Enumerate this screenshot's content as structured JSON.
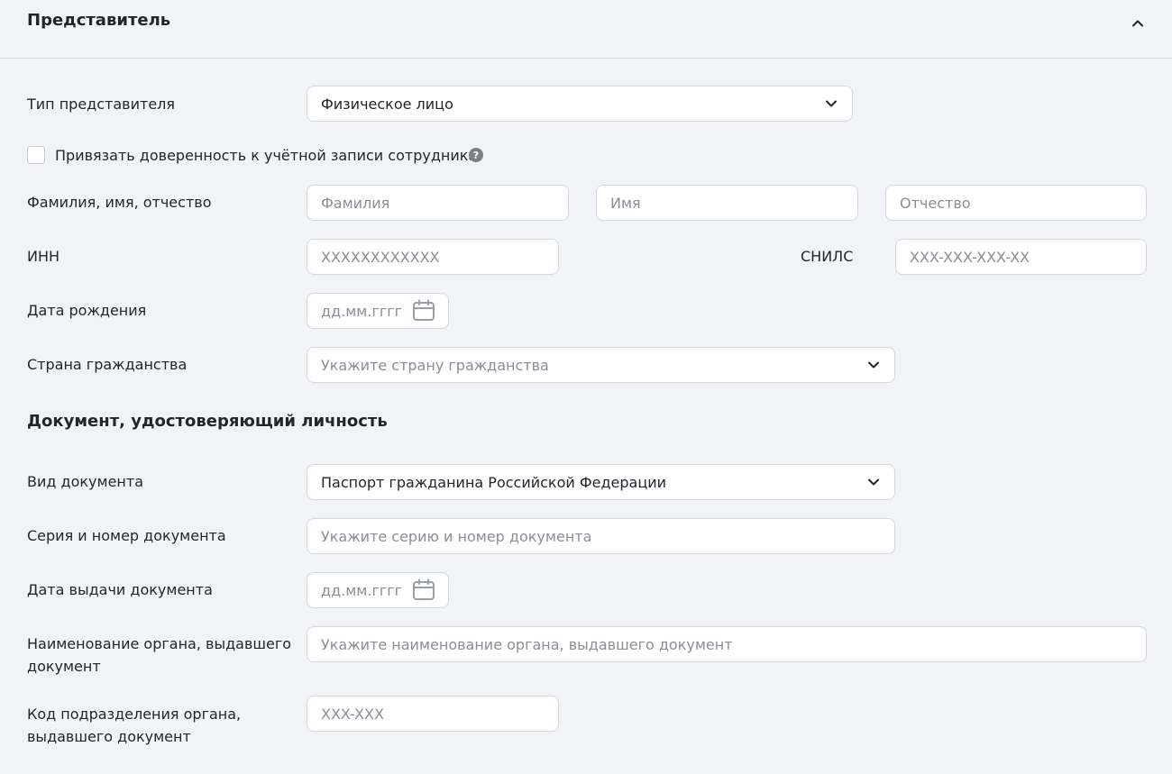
{
  "header": {
    "title": "Представитель"
  },
  "rep_type": {
    "label": "Тип представителя",
    "value": "Физическое лицо"
  },
  "link_account": {
    "label": "Привязать доверенность к учётной записи сотрудника",
    "help": "?"
  },
  "full_name": {
    "label": "Фамилия, имя, отчество",
    "surname_placeholder": "Фамилия",
    "name_placeholder": "Имя",
    "patronymic_placeholder": "Отчество"
  },
  "inn": {
    "label": "ИНН",
    "placeholder": "XXXXXXXXXXXX"
  },
  "snils": {
    "label": "СНИЛС",
    "placeholder": "XXX-XXX-XXX-XX"
  },
  "birth_date": {
    "label": "Дата рождения",
    "placeholder": "дд.мм.гггг"
  },
  "citizenship": {
    "label": "Страна гражданства",
    "placeholder": "Укажите страну гражданства"
  },
  "doc_section": {
    "title": "Документ, удостоверяющий личность"
  },
  "doc_type": {
    "label": "Вид документа",
    "value": "Паспорт гражданина Российской Федерации"
  },
  "doc_number": {
    "label": "Серия и номер документа",
    "placeholder": "Укажите серию и номер документа"
  },
  "issue_date": {
    "label": "Дата выдачи документа",
    "placeholder": "дд.мм.гггг"
  },
  "issuer": {
    "label_line1": "Наименование органа, выдавшего",
    "label_line2": "документ",
    "placeholder": "Укажите наименование органа, выдавшего документ"
  },
  "dept_code": {
    "label_line1": "Код подразделения органа,",
    "label_line2": "выдавшего документ",
    "placeholder": "XXX-XXX"
  },
  "icons": {
    "collapse": "chevron-up-icon",
    "dropdown": "chevron-down-icon",
    "calendar": "calendar-icon",
    "help": "question-circle-icon"
  }
}
